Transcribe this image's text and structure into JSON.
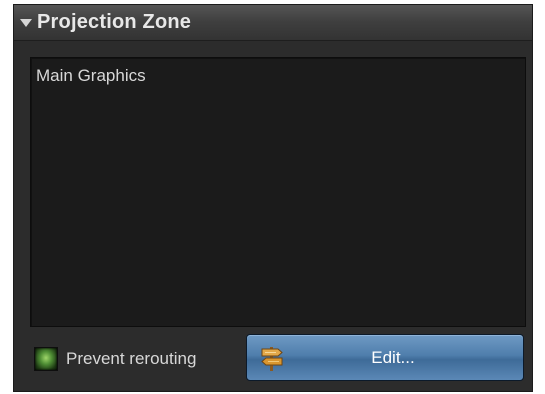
{
  "panel": {
    "title": "Projection Zone",
    "collapse_icon": "triangle-down-icon",
    "zones": [
      {
        "label": "Main Graphics"
      }
    ]
  },
  "footer": {
    "checkbox": {
      "label": "Prevent rerouting",
      "checked": true,
      "indicator_color": "#4e8d34"
    },
    "edit_button": {
      "label": "Edit...",
      "icon": "signpost-icon",
      "color": "#4f7eac"
    }
  }
}
